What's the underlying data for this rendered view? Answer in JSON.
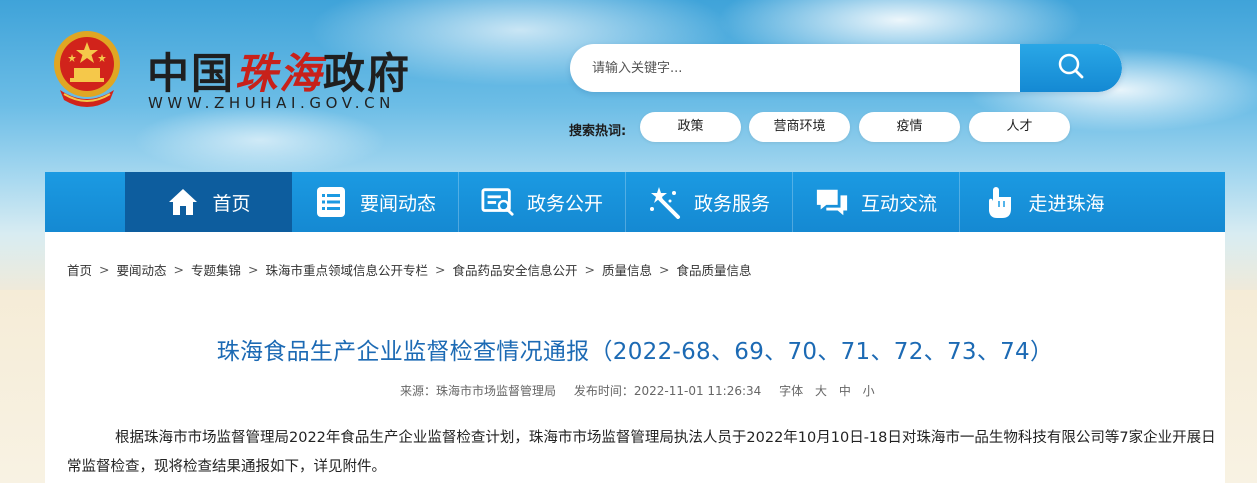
{
  "header": {
    "site_name_prefix": "中国",
    "site_name_red": "珠海",
    "site_name_suffix": "政府",
    "site_url": "WWW.ZHUHAI.GOV.CN"
  },
  "search": {
    "placeholder": "请输入关键字...",
    "hot_label": "搜索热词:",
    "hot_tags": [
      "政策",
      "营商环境",
      "疫情",
      "人才"
    ]
  },
  "nav": {
    "items": [
      {
        "label": "首页",
        "icon": "home-icon"
      },
      {
        "label": "要闻动态",
        "icon": "list-icon"
      },
      {
        "label": "政务公开",
        "icon": "document-search-icon"
      },
      {
        "label": "政务服务",
        "icon": "magic-wand-icon"
      },
      {
        "label": "互动交流",
        "icon": "chat-icon"
      },
      {
        "label": "走进珠海",
        "icon": "hand-pointer-icon"
      }
    ]
  },
  "breadcrumb": [
    "首页",
    "要闻动态",
    "专题集锦",
    "珠海市重点领域信息公开专栏",
    "食品药品安全信息公开",
    "质量信息",
    "食品质量信息"
  ],
  "article": {
    "title": "珠海食品生产企业监督检查情况通报（2022-68、69、70、71、72、73、74）",
    "source": "来源：珠海市市场监督管理局",
    "published": "发布时间：2022-11-01 11:26:34",
    "font_label": "字体",
    "font_sizes": [
      "大",
      "中",
      "小"
    ],
    "body": "根据珠海市市场监督管理局2022年食品生产企业监督检查计划，珠海市市场监督管理局执法人员于2022年10月10日-18日对珠海市一品生物科技有限公司等7家企业开展日常监督检查，现将检查结果通报如下，详见附件。"
  },
  "colors": {
    "nav_blue": "#1b9ae2",
    "nav_active": "#0d5d9e",
    "title_blue": "#1c6ab4",
    "brand_red": "#c8211a"
  }
}
